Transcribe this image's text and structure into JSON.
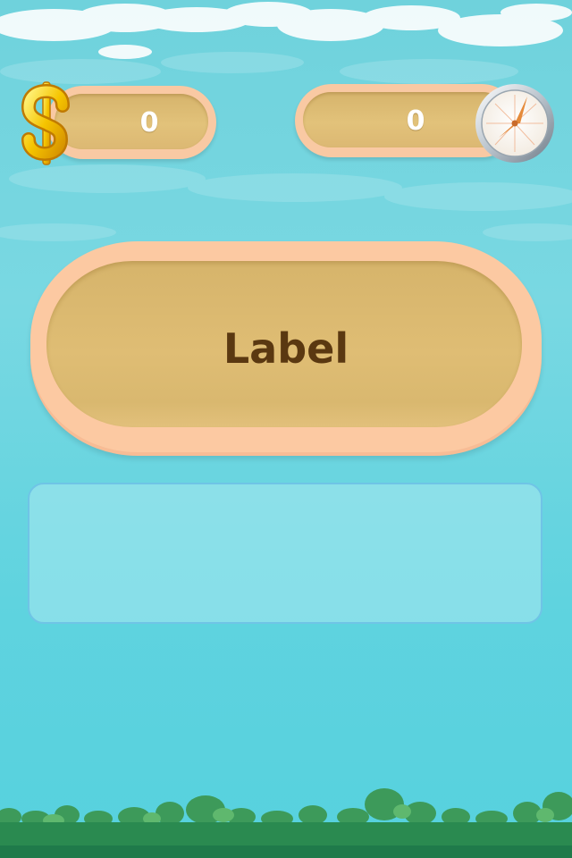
{
  "hud": {
    "coins": {
      "value": "0",
      "icon": "dollar-icon"
    },
    "time": {
      "value": "0",
      "icon": "clock-icon"
    }
  },
  "main": {
    "label": "Label"
  },
  "info_panel": {
    "text": ""
  },
  "colors": {
    "sky": "#6fd2dc",
    "pill_border": "#f9c9a3",
    "pill_fill": "#dcb873",
    "label_text": "#5a3811",
    "ground": "#1f7a4a"
  }
}
